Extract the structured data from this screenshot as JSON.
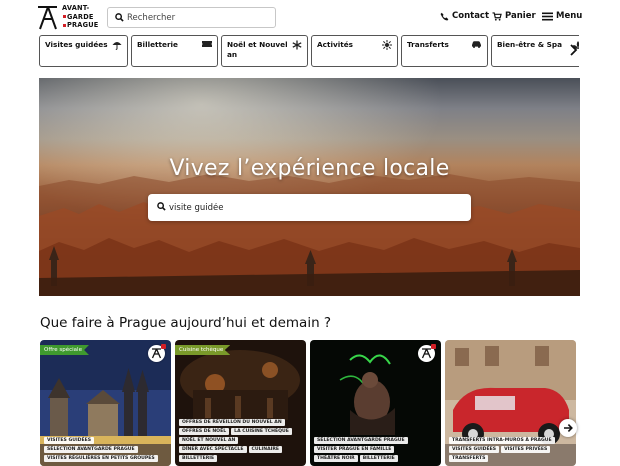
{
  "header": {
    "logo_lines": [
      "AVANT-",
      "GARDE",
      "PRAGUE"
    ],
    "search_placeholder": "Rechercher",
    "contact_label": "Contact",
    "cart_label": "Panier",
    "menu_label": "Menu"
  },
  "categories": [
    {
      "label": "Visites guidées",
      "icon": "umbrella-icon"
    },
    {
      "label": "Billetterie",
      "icon": "ticket-icon"
    },
    {
      "label": "Noël et Nouvel an",
      "icon": "snowflake-icon"
    },
    {
      "label": "Activités",
      "icon": "burst-icon"
    },
    {
      "label": "Transferts",
      "icon": "car-icon"
    },
    {
      "label": "Bien-être & Spa",
      "icon": "spa-icon"
    }
  ],
  "hero": {
    "title": "Vivez l’expérience locale",
    "search_placeholder": "visite guidée"
  },
  "section": {
    "title": "Que faire à Prague aujourd’hui et demain ?"
  },
  "cards": [
    {
      "ribbon": "Offre spéciale",
      "ribbon_color": "#3f9a2e",
      "has_badge": true,
      "tags": [
        "VISITES GUIDÉES",
        "SÉLECTION AVANTGARDE PRAGUE",
        "VISITES RÉGULIÈRES EN PETITS GROUPES"
      ]
    },
    {
      "ribbon": "Cuisine tchèque",
      "ribbon_color": "#7a9a2a",
      "has_badge": false,
      "tags": [
        "OFFRES DE RÉVEILLON DU NOUVEL AN",
        "OFFRES DE NOËL",
        "LA CUISINE TCHÈQUE",
        "NOËL ET NOUVEL AN",
        "DÎNER AVEC SPECTACLE",
        "CULINAIRE",
        "BILLETTERIE"
      ]
    },
    {
      "ribbon": "",
      "ribbon_color": "",
      "has_badge": true,
      "tags": [
        "SÉLECTION AVANTGARDE PRAGUE",
        "VISITER PRAGUE EN FAMILLE",
        "THÉÂTRE NOIR",
        "BILLETTERIE"
      ]
    },
    {
      "ribbon": "",
      "ribbon_color": "",
      "has_badge": false,
      "tags": [
        "TRANSFERTS INTRA-MUROS À PRAGUE",
        "VISITES GUIDÉES",
        "VISITES PRIVÉES",
        "TRANSFERTS"
      ]
    }
  ],
  "colors": {
    "brand_red": "#d31f26",
    "border": "#555555"
  }
}
